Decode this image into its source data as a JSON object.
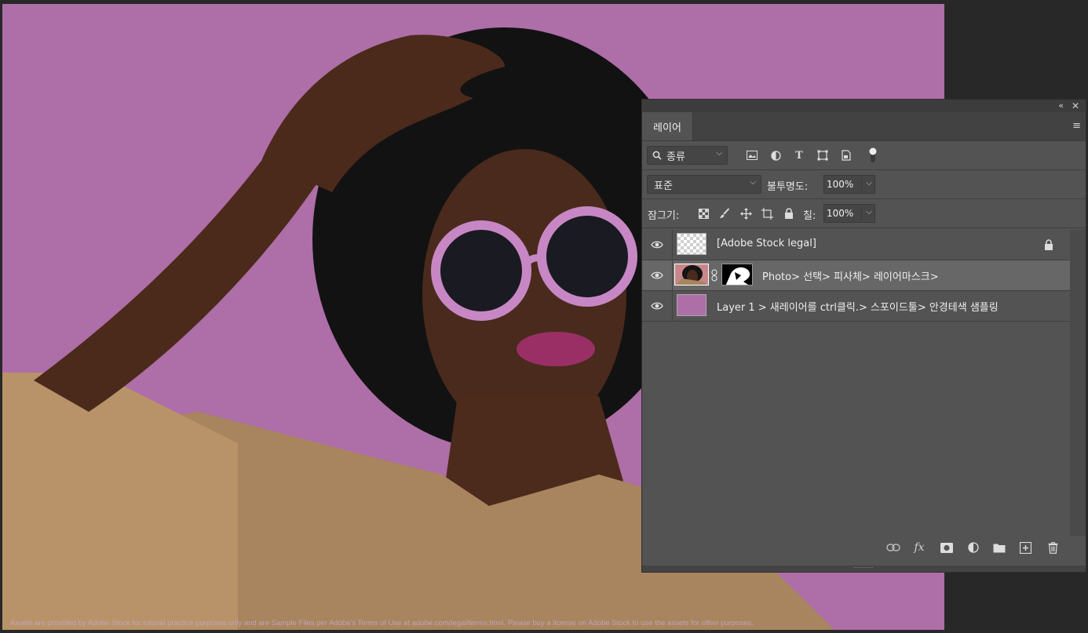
{
  "canvas": {
    "background_color": "#ae6ea8",
    "legal_text": "Assets are provided by Adobe Stock for tutorial practice purposes only and are Sample Files per Adobe's Terms of Use at adobe.com/legal/terms.html. Please buy a license on Adobe Stock to use the assets for other purposes."
  },
  "panel": {
    "collapse_icon": "«",
    "close_icon": "✕",
    "tab_label": "레이어",
    "menu_icon": "≡",
    "filter": {
      "kind_label": "종류",
      "icons": [
        "image-filter-icon",
        "adjustment-filter-icon",
        "type-filter-icon",
        "shape-filter-icon",
        "smart-object-filter-icon",
        "filter-toggle-icon"
      ]
    },
    "blend": {
      "mode": "표준",
      "opacity_label": "불투명도:",
      "opacity_value": "100%"
    },
    "lock": {
      "label": "잠그기:",
      "fill_label": "칠:",
      "fill_value": "100%"
    },
    "layers": [
      {
        "name": "[Adobe Stock legal]",
        "visible": true,
        "locked": true,
        "selected": false
      },
      {
        "name": "Photo> 선택> 피사체> 레이어마스크>",
        "visible": true,
        "locked": false,
        "selected": true
      },
      {
        "name": "Layer 1 > 새레이어를 ctrl클릭.> 스포이드툴> 안경테색 샘플링",
        "visible": true,
        "locked": false,
        "selected": false
      }
    ],
    "layer_swatch_color": "#ae6ea8",
    "bottom_icons": [
      "link-layers-icon",
      "fx-icon",
      "add-mask-icon",
      "adjustment-layer-icon",
      "new-group-icon",
      "new-layer-icon",
      "delete-layer-icon"
    ],
    "fx_label": "fx"
  }
}
